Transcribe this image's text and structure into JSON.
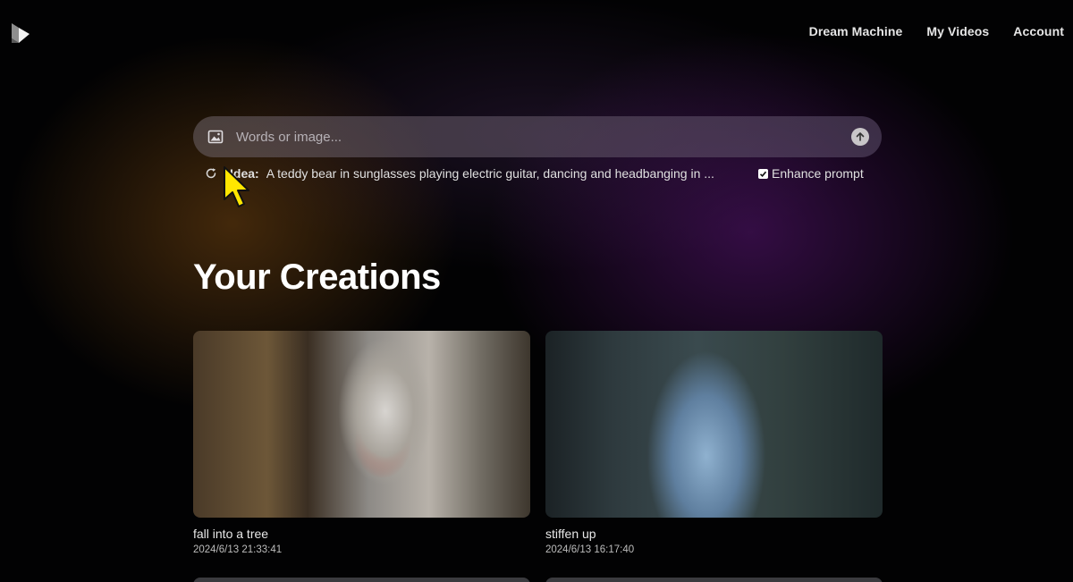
{
  "nav": {
    "items": [
      "Dream Machine",
      "My Videos",
      "Account"
    ]
  },
  "prompt": {
    "placeholder": "Words or image..."
  },
  "idea": {
    "label": "Idea:",
    "text": "A teddy bear in sunglasses playing electric guitar, dancing and headbanging in ..."
  },
  "enhance": {
    "label": "Enhance prompt",
    "checked": true
  },
  "creations": {
    "title": "Your Creations",
    "items": [
      {
        "title": "fall into a tree",
        "date": "2024/6/13 21:33:41"
      },
      {
        "title": "stiffen up",
        "date": "2024/6/13 16:17:40"
      }
    ]
  },
  "colors": {
    "background": "#020203",
    "text": "#ffffff",
    "muted": "#bdbdbd"
  }
}
